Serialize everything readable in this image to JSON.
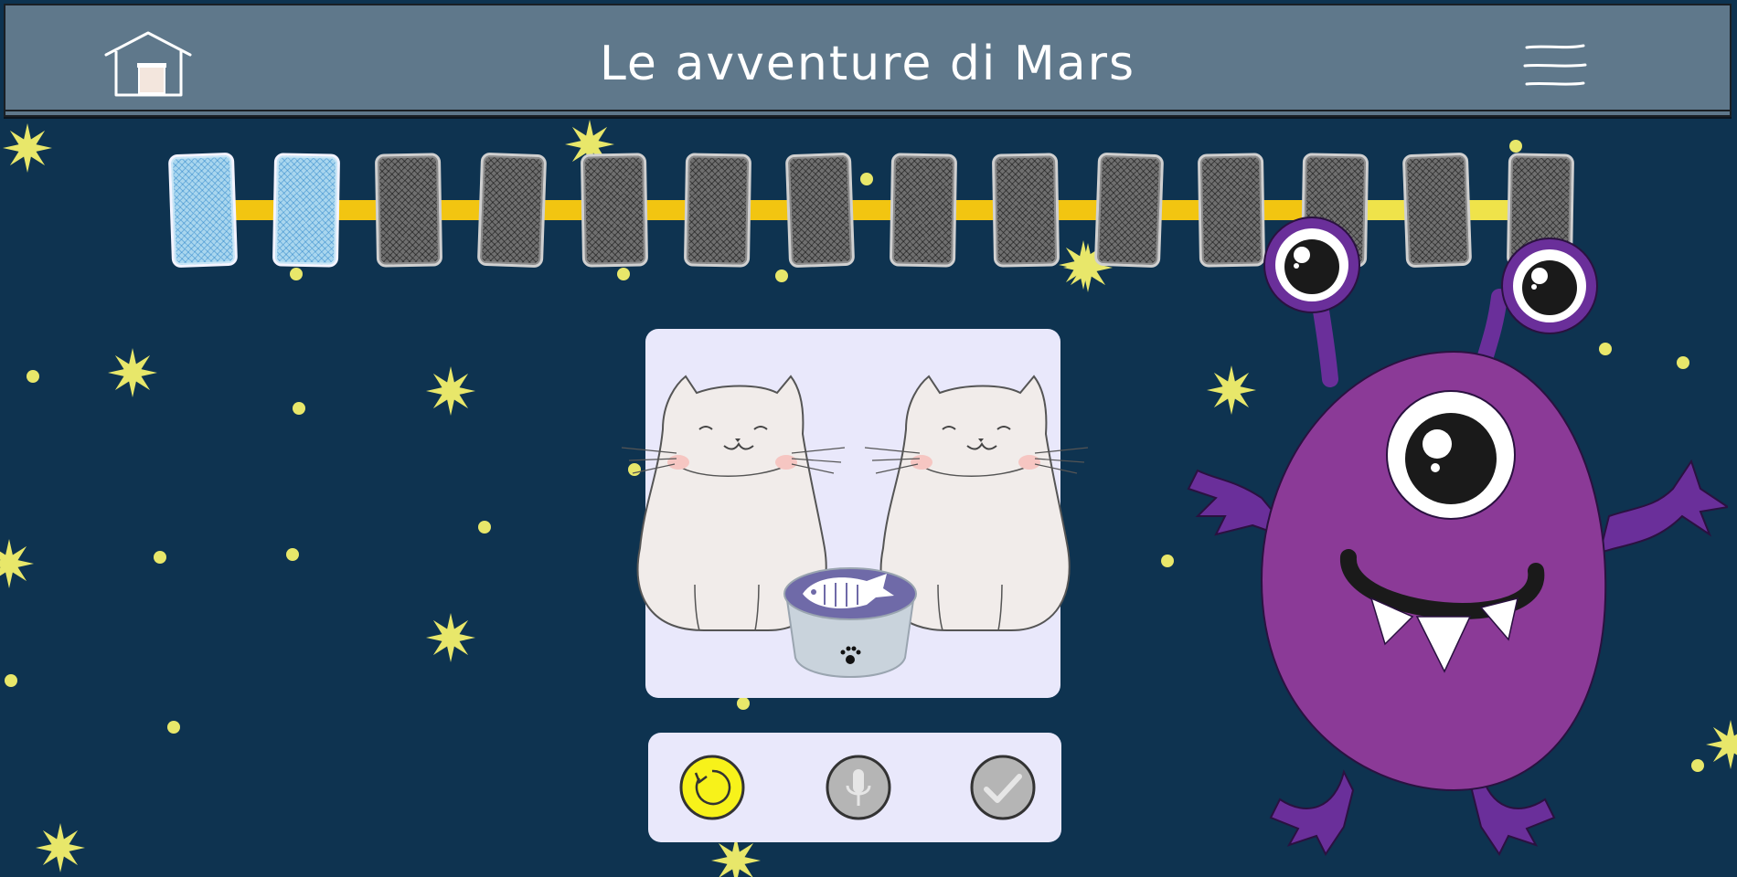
{
  "app": {
    "title": "Le avventure di Mars"
  },
  "header": {
    "home_icon": "home-icon",
    "menu_icon": "hamburger-menu-icon"
  },
  "progress": {
    "total_cards": 14,
    "completed_cards": 2
  },
  "picture": {
    "icon": "two-cats-with-fish-bowl-illustration"
  },
  "controls": {
    "replay": {
      "icon": "replay-icon",
      "color": "#f7f21a",
      "active": true
    },
    "microphone": {
      "icon": "microphone-icon",
      "color": "#b5b5b5",
      "active": false
    },
    "confirm": {
      "icon": "checkmark-icon",
      "color": "#b5b5b5",
      "active": false
    }
  },
  "character": {
    "icon": "purple-monster-mars"
  },
  "colors": {
    "background": "#0e3350",
    "header": "#5f788b",
    "track": "#f2c511",
    "star": "#e8e76a",
    "monster": "#8b3a97"
  }
}
